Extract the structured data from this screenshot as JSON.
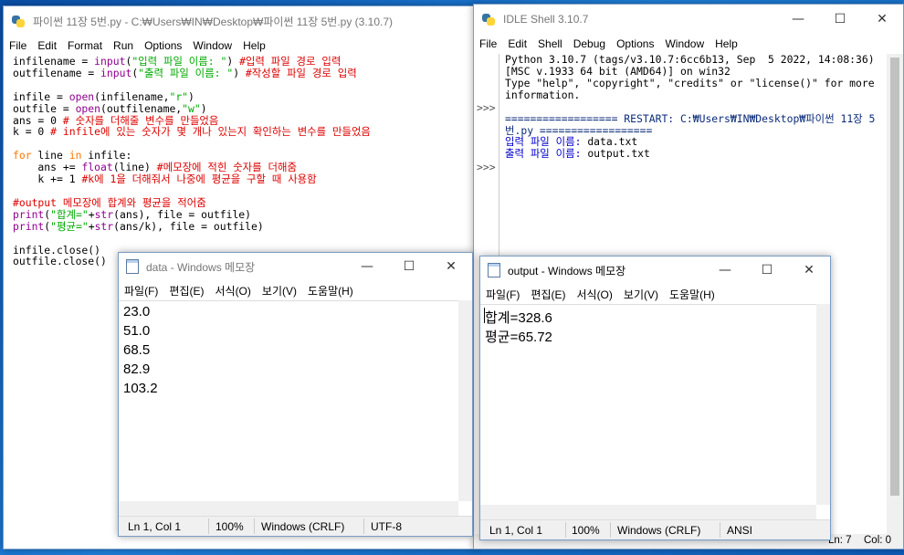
{
  "editor": {
    "title": "파이썬 11장 5번.py - C:₩Users₩IN₩Desktop₩파이썬 11장 5번.py (3.10.7)",
    "menu": [
      "File",
      "Edit",
      "Format",
      "Run",
      "Options",
      "Window",
      "Help"
    ]
  },
  "shell": {
    "title": "IDLE Shell 3.10.7",
    "menu": [
      "File",
      "Edit",
      "Shell",
      "Debug",
      "Options",
      "Window",
      "Help"
    ],
    "banner_line1": "Python 3.10.7 (tags/v3.10.7:6cc6b13, Sep  5 2022, 14:08:36) [MSC v.1933 64 bit (AMD64)] on win32",
    "banner_line2": "Type \"help\", \"copyright\", \"credits\" or \"license()\" for more information.",
    "prompt": ">>>",
    "restart_line": "================== RESTART: C:₩Users₩IN₩Desktop₩파이썬 11장 5번.py ==================",
    "input_prompt1": "입력 파일 이름: ",
    "input_value1": "data.txt",
    "input_prompt2": "출력 파일 이름: ",
    "input_value2": "output.txt",
    "status_ln": "Ln: 7",
    "status_col": "Col: 0"
  },
  "notepad_data": {
    "title": "data - Windows 메모장",
    "menu": [
      "파일(F)",
      "편집(E)",
      "서식(O)",
      "보기(V)",
      "도움말(H)"
    ],
    "lines": [
      "23.0",
      "51.0",
      "68.5",
      "82.9",
      "103.2"
    ],
    "status": {
      "pos": "Ln 1, Col 1",
      "zoom": "100%",
      "eol": "Windows (CRLF)",
      "enc": "UTF-8"
    }
  },
  "notepad_output": {
    "title": "output - Windows 메모장",
    "menu": [
      "파일(F)",
      "편집(E)",
      "서식(O)",
      "보기(V)",
      "도움말(H)"
    ],
    "lines": [
      "합계=328.6",
      "평균=65.72"
    ],
    "status": {
      "pos": "Ln 1, Col 1",
      "zoom": "100%",
      "eol": "Windows (CRLF)",
      "enc": "ANSI"
    }
  },
  "controls": {
    "minimize": "—",
    "maximize": "☐",
    "close": "✕"
  }
}
